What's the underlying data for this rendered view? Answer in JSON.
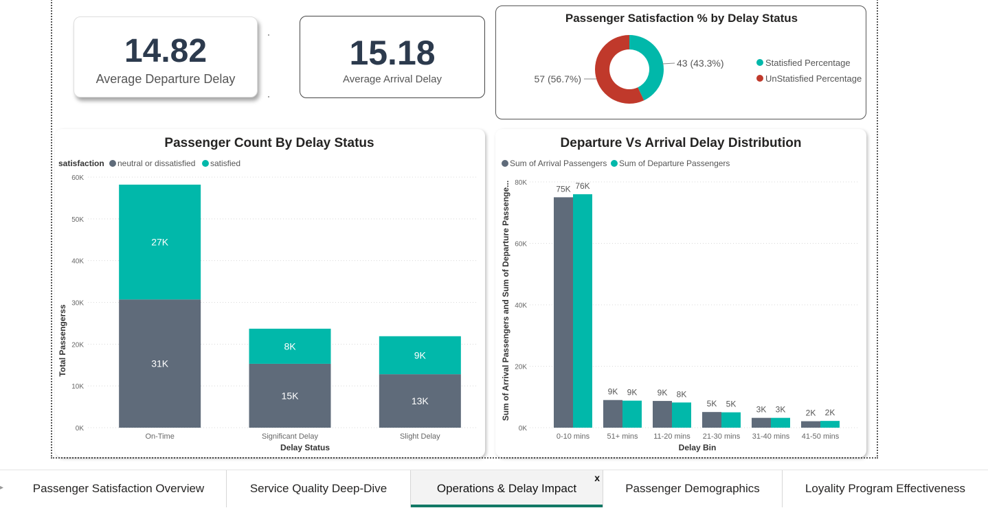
{
  "kpis": {
    "departure": {
      "value": "14.82",
      "label": "Average Departure Delay"
    },
    "arrival": {
      "value": "15.18",
      "label": "Average Arrival Delay"
    }
  },
  "donut": {
    "title": "Passenger Satisfaction % by Delay Status",
    "slices": [
      {
        "name": "Statisfied Percentage",
        "value": 43,
        "label": "43 (43.3%)",
        "percent": 43.3,
        "color": "#01b8aa"
      },
      {
        "name": "UnStatisfied Percentage",
        "value": 57,
        "label": "57 (56.7%)",
        "percent": 56.7,
        "color": "#c0392b"
      }
    ]
  },
  "tabs": [
    {
      "label": "Passenger Satisfaction Overview",
      "active": false
    },
    {
      "label": "Service Quality Deep-Dive",
      "active": false
    },
    {
      "label": "Operations & Delay Impact",
      "active": true,
      "close": "x"
    },
    {
      "label": "Passenger Demographics",
      "active": false
    },
    {
      "label": "Loyality Program Effectiveness",
      "active": false
    }
  ],
  "colors": {
    "teal": "#01b8aa",
    "slate": "#5f6b7a",
    "red": "#c0392b",
    "tab_accent": "#117865"
  },
  "chart_data": [
    {
      "type": "bar",
      "stacked": true,
      "title": "Passenger Count By Delay Status",
      "legend_title": "satisfaction",
      "legend_position": "top-left",
      "xlabel": "Delay Status",
      "ylabel": "Total Passengerss",
      "categories": [
        "On-Time",
        "Significant Delay",
        "Slight Delay"
      ],
      "series": [
        {
          "name": "neutral or dissatisfied",
          "color": "#5f6b7a",
          "values": [
            30700,
            15300,
            12800
          ],
          "labels": [
            "31K",
            "15K",
            "13K"
          ]
        },
        {
          "name": "satisfied",
          "color": "#01b8aa",
          "values": [
            27500,
            8400,
            9100
          ],
          "labels": [
            "27K",
            "8K",
            "9K"
          ]
        }
      ],
      "ylim": [
        0,
        60000
      ],
      "yticks": [
        0,
        10000,
        20000,
        30000,
        40000,
        50000,
        60000
      ],
      "ytick_labels": [
        "0K",
        "10K",
        "20K",
        "30K",
        "40K",
        "50K",
        "60K"
      ],
      "grid": true
    },
    {
      "type": "bar",
      "stacked": false,
      "title": "Departure Vs Arrival Delay Distribution",
      "legend_position": "top-left",
      "xlabel": "Delay Bin",
      "ylabel": "Sum of Arrival Passengers and Sum of Departure Passenge...",
      "categories": [
        "0-10 mins",
        "51+ mins",
        "11-20 mins",
        "21-30 mins",
        "31-40 mins",
        "41-50 mins"
      ],
      "series": [
        {
          "name": "Sum of Arrival Passengers",
          "color": "#5f6b7a",
          "values": [
            75000,
            9000,
            8700,
            5100,
            3200,
            2100
          ],
          "labels": [
            "75K",
            "9K",
            "9K",
            "5K",
            "3K",
            "2K"
          ]
        },
        {
          "name": "Sum of Departure Passengers",
          "color": "#01b8aa",
          "values": [
            76000,
            8800,
            8200,
            5000,
            3200,
            2200
          ],
          "labels": [
            "76K",
            "9K",
            "8K",
            "5K",
            "3K",
            "2K"
          ]
        }
      ],
      "ylim": [
        0,
        80000
      ],
      "yticks": [
        0,
        20000,
        40000,
        60000,
        80000
      ],
      "ytick_labels": [
        "0K",
        "20K",
        "40K",
        "60K",
        "80K"
      ],
      "grid": true
    }
  ]
}
